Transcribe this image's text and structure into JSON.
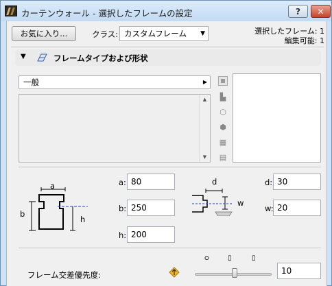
{
  "window": {
    "title": "カーテンウォール - 選択したフレームの設定"
  },
  "titlebar": {
    "help_label": "?",
    "close_label": "✕"
  },
  "toolbar": {
    "favorites_label": "お気に入り...",
    "class_label": "クラス:",
    "class_value": "カスタムフレーム",
    "selected_label": "選択したフレーム: 1",
    "editable_label": "編集可能: 1"
  },
  "panel": {
    "header": "フレームタイプおよび形状",
    "type_value": "一般"
  },
  "params": {
    "a_label": "a:",
    "a_value": "80",
    "b_label": "b:",
    "b_value": "250",
    "h_label": "h:",
    "h_value": "200",
    "d_label": "d:",
    "d_value": "30",
    "w_label": "w:",
    "w_value": "20"
  },
  "diagram_labels": {
    "a": "a",
    "b": "b",
    "h": "h",
    "d": "d",
    "w": "w"
  },
  "priority": {
    "label": "フレーム交差優先度:",
    "value": "10",
    "level": 0.55
  },
  "colors": {
    "accent_line": "#1f3fbf",
    "priority_icon": "#f1b62a"
  }
}
